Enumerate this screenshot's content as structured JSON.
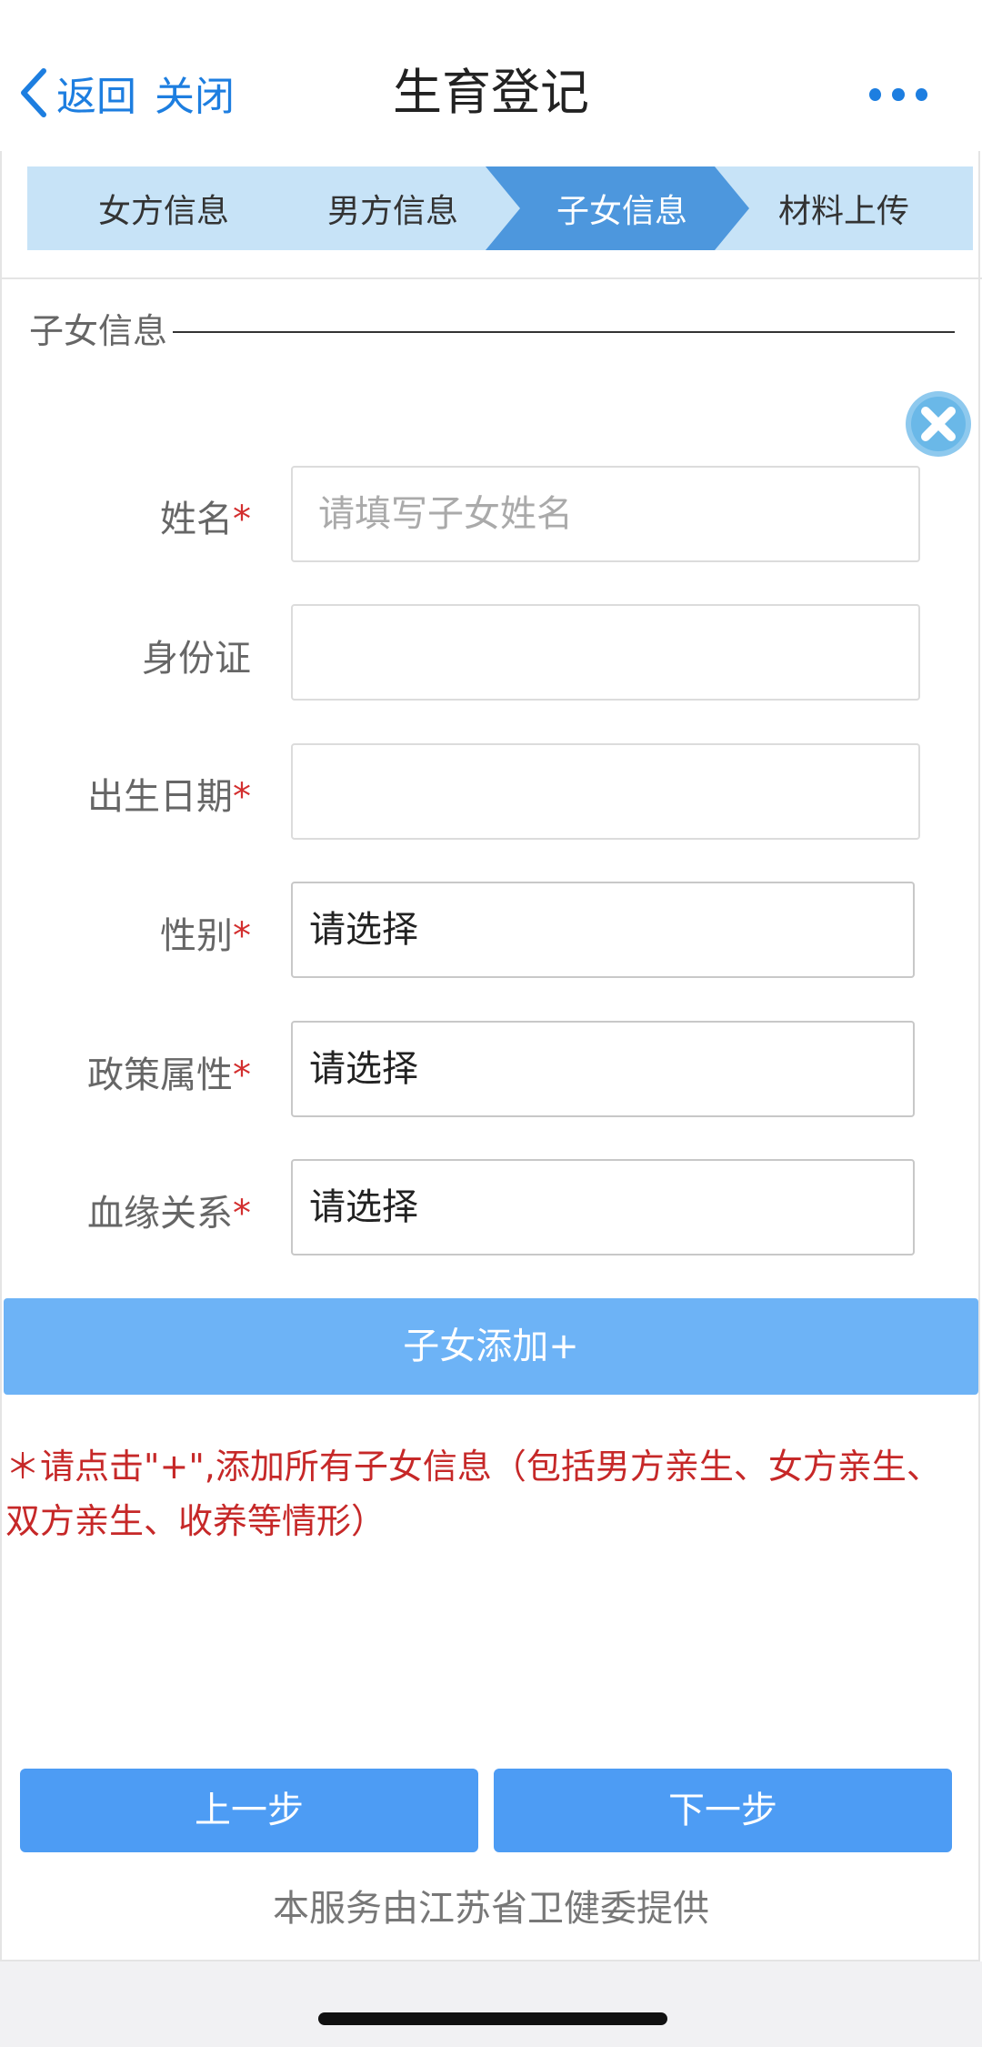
{
  "header": {
    "back_label": "返回",
    "close_label": "关闭",
    "title": "生育登记"
  },
  "steps": [
    {
      "label": "女方信息",
      "active": false
    },
    {
      "label": "男方信息",
      "active": false
    },
    {
      "label": "子女信息",
      "active": true
    },
    {
      "label": "材料上传",
      "active": false
    }
  ],
  "section": {
    "title": "子女信息"
  },
  "form": {
    "name": {
      "label": "姓名",
      "required_mark": "*",
      "placeholder": "请填写子女姓名",
      "value": ""
    },
    "id_card": {
      "label": "身份证",
      "value": ""
    },
    "birth_date": {
      "label": "出生日期",
      "required_mark": "*",
      "value": ""
    },
    "gender": {
      "label": "性别",
      "required_mark": "*",
      "selected": "请选择"
    },
    "policy": {
      "label": "政策属性",
      "required_mark": "*",
      "selected": "请选择"
    },
    "relation": {
      "label": "血缘关系",
      "required_mark": "*",
      "selected": "请选择"
    }
  },
  "add_button": "子女添加+",
  "note": "＊请点击\"+\",添加所有子女信息（包括男方亲生、女方亲生、双方亲生、收养等情形）",
  "nav": {
    "prev": "上一步",
    "next": "下一步"
  },
  "footer": "本服务由江苏省卫健委提供",
  "colors": {
    "accent": "#1d7ee0",
    "step_inactive": "#c7e3f7",
    "step_active": "#4d97dd",
    "button": "#4d9cf4",
    "add_button": "#6db3f6",
    "required": "#d32f2f"
  }
}
